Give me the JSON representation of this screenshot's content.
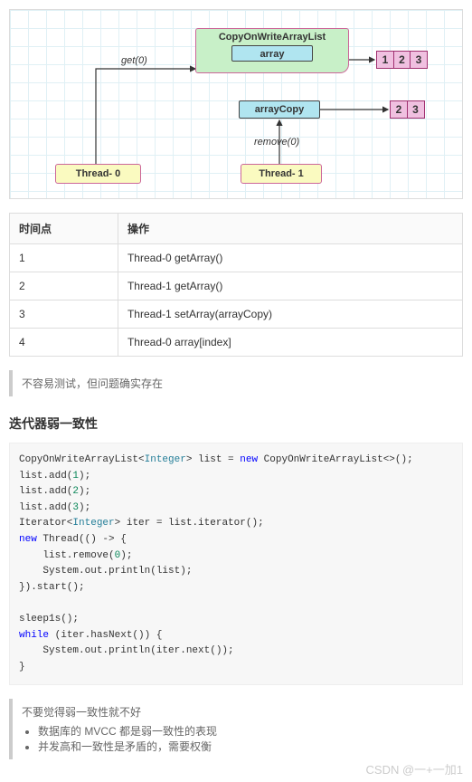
{
  "diagram": {
    "cowlist_title": "CopyOnWriteArrayList",
    "array_label": "array",
    "arraycopy_label": "arrayCopy",
    "cells_top": [
      "1",
      "2",
      "3"
    ],
    "cells_bottom": [
      "2",
      "3"
    ],
    "thread0": "Thread- 0",
    "thread1": "Thread- 1",
    "label_get": "get(0)",
    "label_remove": "remove(0)"
  },
  "table": {
    "head_col1": "时间点",
    "head_col2": "操作",
    "rows": [
      {
        "t": "1",
        "op": "Thread-0 getArray()"
      },
      {
        "t": "2",
        "op": "Thread-1 getArray()"
      },
      {
        "t": "3",
        "op": "Thread-1 setArray(arrayCopy)"
      },
      {
        "t": "4",
        "op": "Thread-0 array[index]"
      }
    ]
  },
  "quote1": "不容易测试，但问题确实存在",
  "section_title": "迭代器弱一致性",
  "code": {
    "l1a": "CopyOnWriteArrayList<",
    "l1b": "Integer",
    "l1c": "> list = ",
    "l1d": "new",
    "l1e": " CopyOnWriteArrayList<>();",
    "l2a": "list.add(",
    "l2b": "1",
    "l2c": ");",
    "l3a": "list.add(",
    "l3b": "2",
    "l3c": ");",
    "l4a": "list.add(",
    "l4b": "3",
    "l4c": ");",
    "l5a": "Iterator<",
    "l5b": "Integer",
    "l5c": "> iter = list.iterator();",
    "l6a": "new",
    "l6b": " Thread(() -> {",
    "l7a": "    list.remove(",
    "l7b": "0",
    "l7c": ");",
    "l8": "    System.out.println(list);",
    "l9": "}).start();",
    "blank": "",
    "l10": "sleep1s();",
    "l11a": "while",
    "l11b": " (iter.hasNext()) {",
    "l12": "    System.out.println(iter.next());",
    "l13": "}"
  },
  "quote2": {
    "head": "不要觉得弱一致性就不好",
    "b1": "数据库的 MVCC 都是弱一致性的表现",
    "b2": "并发高和一致性是矛盾的，需要权衡"
  },
  "watermark": "CSDN @一+一加1"
}
